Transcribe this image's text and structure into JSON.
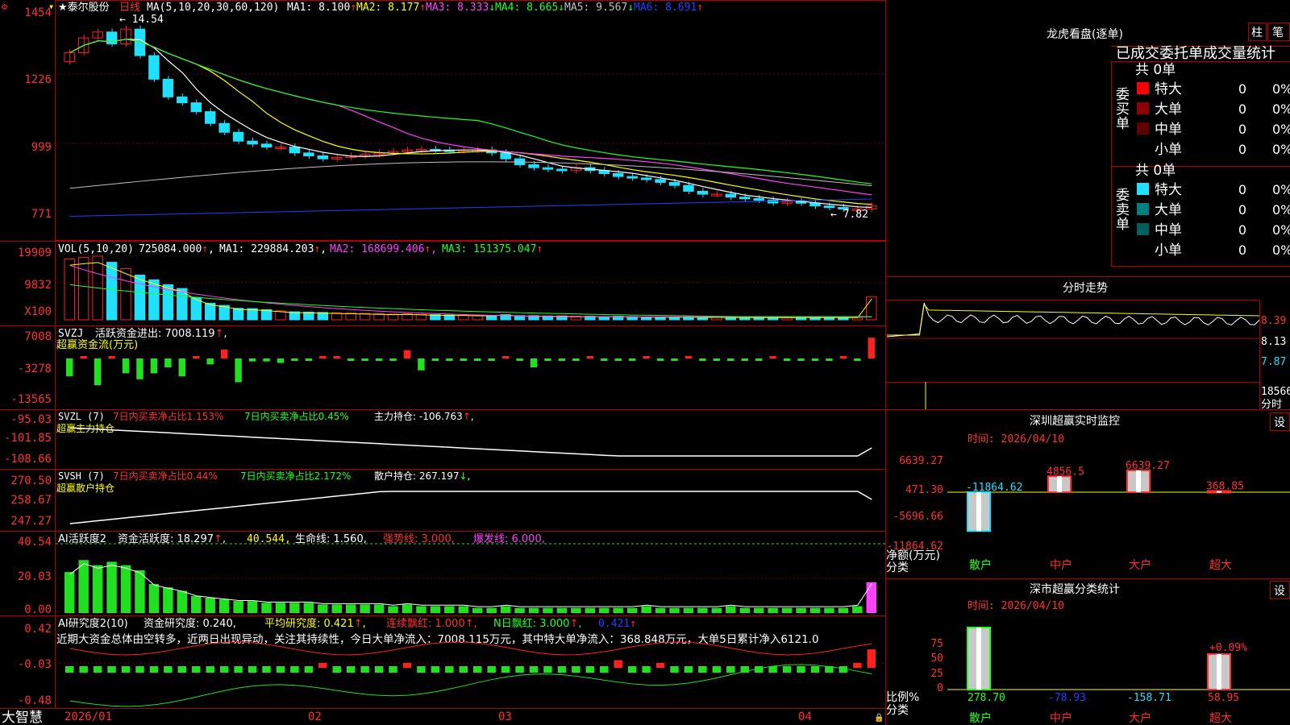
{
  "colors": {
    "up": "#ff2020",
    "down": "#20e0ff",
    "ma1": "#ffffff",
    "ma2": "#ffff00",
    "ma3": "#ff40ff",
    "ma4": "#20ff20",
    "ma5": "#c0c0c0",
    "ma6": "#2040ff",
    "grid": "#b00000",
    "green": "#20e020",
    "yellow": "#ffff00"
  },
  "stock": {
    "title": "★泰尔股份",
    "period": "日线",
    "ma_def": "MA(5,10,20,30,60,120)",
    "ma": [
      {
        "k": "MA1:",
        "v": "8.100",
        "a": "↑"
      },
      {
        "k": "MA2:",
        "v": "8.177",
        "a": "↑"
      },
      {
        "k": "MA3:",
        "v": "8.333",
        "a": "↓"
      },
      {
        "k": "MA4:",
        "v": "8.665",
        "a": "↓"
      },
      {
        "k": "MA5:",
        "v": "9.567",
        "a": "↓"
      },
      {
        "k": "MA6:",
        "v": "8.691",
        "a": "↑"
      }
    ],
    "hi_label": "14.54",
    "lo_label": "7.82"
  },
  "axes": {
    "price": [
      "1454",
      "1226",
      "999",
      "771"
    ],
    "vol": [
      "19909",
      "9832",
      "X100"
    ],
    "svzj": [
      "7008",
      "-3278",
      "-13565"
    ],
    "svzl": [
      "-95.03",
      "-101.85",
      "-108.66"
    ],
    "svsh": [
      "270.50",
      "258.67",
      "247.27"
    ],
    "huoyue": [
      "40.54",
      "20.03",
      "0.00"
    ],
    "yanjiu": [
      "0.42",
      "-0.03",
      "-0.48"
    ],
    "dates": [
      "2026/01",
      "02",
      "03",
      "04"
    ]
  },
  "vol": {
    "def": "VOL(5,10,20)",
    "v": "725084.000",
    "ma1": "MA1: 229884.203",
    "ma2": "MA2: 168699.406",
    "ma3": "MA3: 151375.047"
  },
  "svzj": {
    "def": "SVZJ",
    "label": "活跃资金进出: 7008.119",
    "sub": "超赢资金流(万元)"
  },
  "svzl": {
    "def": "SVZL (7)",
    "a": "7日内买卖净占比1.153%",
    "b": "7日内买卖净占比0.45%",
    "c": "主力持仓: -106.763",
    "sub": "超赢主力持仓"
  },
  "svsh": {
    "def": "SVSH (7)",
    "a": "7日内买卖净占比0.44%",
    "b": "7日内买卖净占比2.172%",
    "c": "散户持仓: 267.197",
    "sub": "超赢散户持仓"
  },
  "huoyue": {
    "def": "AI活跃度2",
    "a": "资金活跃度: 18.297",
    "b": "40.544",
    "c": "生命线: 1.560",
    "d": "强势线: 3.000",
    "e": "爆发线: 6.000"
  },
  "yanjiu": {
    "def": "AI研究度2(10)",
    "a": "资金研究度: 0.240",
    "b": "平均研究度: 0.421",
    "c": "连续飘红: 1.000",
    "d": "N日飘红: 3.000",
    "e": "0.421",
    "note": "近期大资金总体由空转多，近两日出现异动，关注其持续性，今日大单净流入：7008.115万元，其中特大单净流入：368.848万元，大单5日累计净入6121.0"
  },
  "brand": "大智慧",
  "lhb": {
    "title": "龙虎看盘(逐单)",
    "btn1": "柱",
    "btn2": "笔",
    "sub": "已成交委托单成交量统计",
    "buy": {
      "side": "委买单",
      "total": "共 0单",
      "rows": [
        {
          "n": "特大",
          "v": "0",
          "p": "0%",
          "c": "#ff0000"
        },
        {
          "n": "大单",
          "v": "0",
          "p": "0%",
          "c": "#900000"
        },
        {
          "n": "中单",
          "v": "0",
          "p": "0%",
          "c": "#600000"
        },
        {
          "n": "小单",
          "v": "0",
          "p": "0%",
          "c": "#000000"
        }
      ]
    },
    "sell": {
      "side": "委卖单",
      "total": "共 0单",
      "rows": [
        {
          "n": "特大",
          "v": "0",
          "p": "0%",
          "c": "#20e0ff"
        },
        {
          "n": "大单",
          "v": "0",
          "p": "0%",
          "c": "#008080"
        },
        {
          "n": "中单",
          "v": "0",
          "p": "0%",
          "c": "#006060"
        },
        {
          "n": "小单",
          "v": "0",
          "p": "0%",
          "c": "#000000"
        }
      ]
    }
  },
  "fenshi": {
    "title": "分时走势",
    "y": [
      "8.39",
      "8.13",
      "7.87"
    ],
    "v": "18566",
    "vlabel": "分时"
  },
  "sz": {
    "title": "深圳超赢实时监控",
    "btn": "设",
    "time": "时间: 2026/04/10",
    "y": [
      "6639.27",
      "471.30",
      "-5696.66",
      "-11864.62"
    ],
    "bars": [
      {
        "cat": "散户",
        "v": -11864.62,
        "lbl": "-11864.62"
      },
      {
        "cat": "中户",
        "v": 4856.5,
        "lbl": "4856.5"
      },
      {
        "cat": "大户",
        "v": 6639.27,
        "lbl": "6639.27"
      },
      {
        "cat": "超大",
        "v": 368.85,
        "lbl": "368.85"
      }
    ],
    "ylabel": "净额(万元)",
    "xlabel": "分类"
  },
  "ss": {
    "title": "深市超赢分类统计",
    "btn": "设",
    "time": "时间: 2026/04/10",
    "y": [
      "75",
      "50",
      "25",
      "0"
    ],
    "bars": [
      {
        "cat": "散户",
        "v": 278.7,
        "lbl": "278.70"
      },
      {
        "cat": "中户",
        "v": -78.93,
        "lbl": "-78.93"
      },
      {
        "cat": "大户",
        "v": -158.71,
        "lbl": "-158.71"
      },
      {
        "cat": "超大",
        "v": 58.95,
        "lbl": "58.95"
      }
    ],
    "pct": "+0.09%",
    "ylabel": "比例%",
    "xlabel": "分类"
  }
}
